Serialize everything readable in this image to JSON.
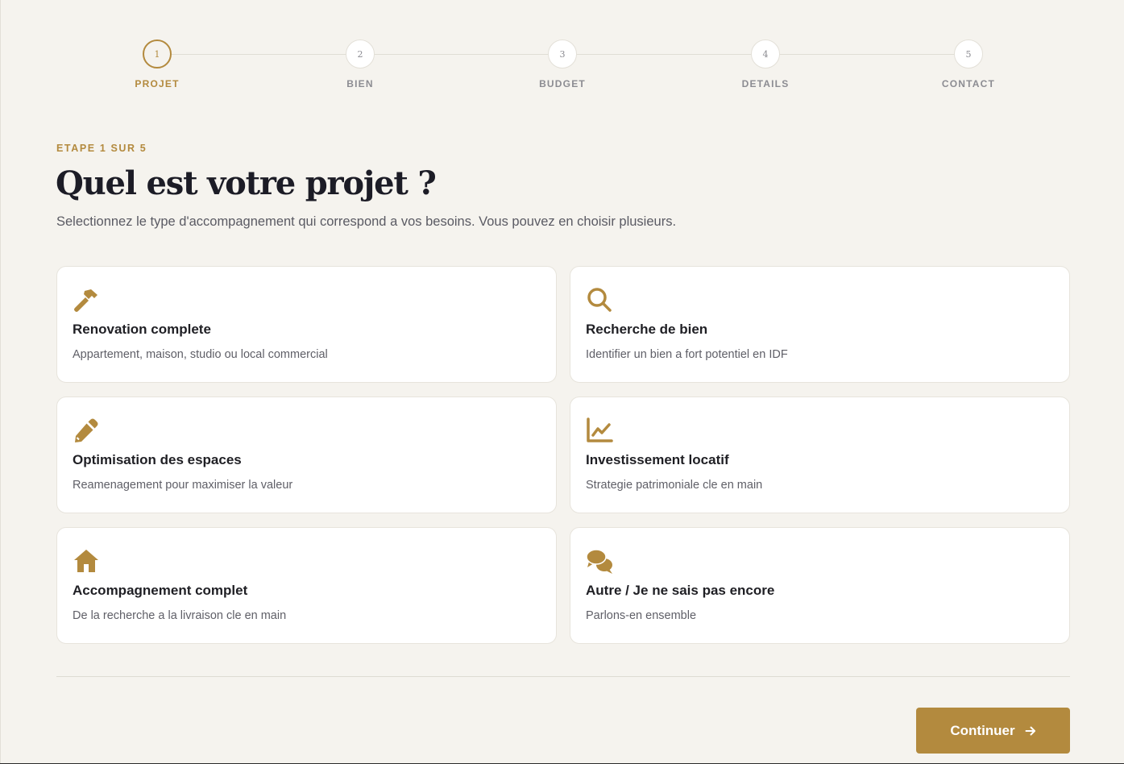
{
  "colors": {
    "accent": "#b38a3e",
    "background": "#f5f3ee",
    "card": "#ffffff",
    "text": "#1f1f24",
    "muted": "#5f5f67"
  },
  "stepper": {
    "steps": [
      {
        "number": "1",
        "label": "PROJET",
        "state": "active"
      },
      {
        "number": "2",
        "label": "BIEN",
        "state": "inactive"
      },
      {
        "number": "3",
        "label": "BUDGET",
        "state": "inactive"
      },
      {
        "number": "4",
        "label": "DETAILS",
        "state": "inactive"
      },
      {
        "number": "5",
        "label": "CONTACT",
        "state": "inactive"
      }
    ]
  },
  "header": {
    "eyebrow": "ETAPE 1 SUR 5",
    "title": "Quel est votre projet ?",
    "subtitle": "Selectionnez le type d'accompagnement qui correspond a vos besoins. Vous pouvez en choisir plusieurs."
  },
  "options": [
    {
      "icon": "hammer-icon",
      "title": "Renovation complete",
      "description": "Appartement, maison, studio ou local commercial"
    },
    {
      "icon": "search-icon",
      "title": "Recherche de bien",
      "description": "Identifier un bien a fort potentiel en IDF"
    },
    {
      "icon": "pencil-icon",
      "title": "Optimisation des espaces",
      "description": "Reamenagement pour maximiser la valeur"
    },
    {
      "icon": "chart-line-icon",
      "title": "Investissement locatif",
      "description": "Strategie patrimoniale cle en main"
    },
    {
      "icon": "house-icon",
      "title": "Accompagnement complet",
      "description": "De la recherche a la livraison cle en main"
    },
    {
      "icon": "chat-bubbles-icon",
      "title": "Autre / Je ne sais pas encore",
      "description": "Parlons-en ensemble"
    }
  ],
  "footer": {
    "continue_label": "Continuer",
    "continue_icon": "arrow-right-icon"
  }
}
